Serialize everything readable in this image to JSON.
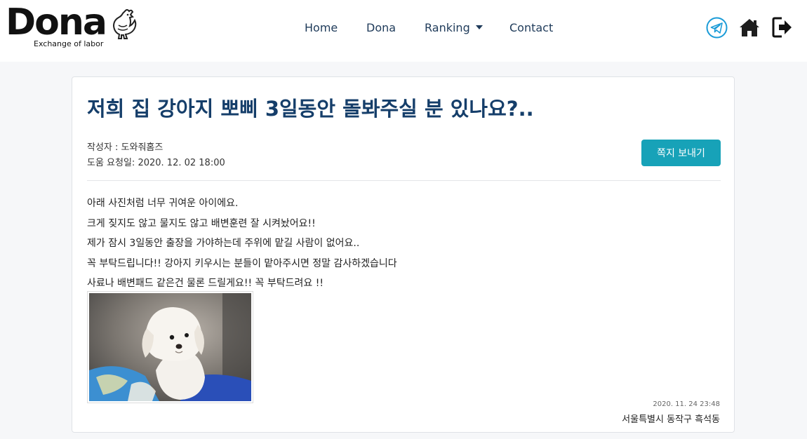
{
  "brand": {
    "name": "Dona",
    "tagline": "Exchange of labor"
  },
  "nav": {
    "home": "Home",
    "dona": "Dona",
    "ranking": "Ranking",
    "contact": "Contact"
  },
  "icons": {
    "telegram": "telegram-icon",
    "home": "home-icon",
    "exit": "sign-out-icon"
  },
  "colors": {
    "title": "#153e6a",
    "button": "#17a2b8",
    "nav": "#1f3b5a"
  },
  "post": {
    "title": "저희 집 강아지 뽀삐 3일동안 돌봐주실 분 있나요?..",
    "author_line": "작성자 : 도와줘홈즈",
    "request_date_line": "도움 요청일: 2020. 12. 02 18:00",
    "message_button": "쪽지 보내기",
    "body": [
      "아래 사진처럼 너무 귀여운 아이에요.",
      "크게 짖지도 않고 물지도 않고 배변훈련 잘 시켜놨어요!!",
      "제가 잠시 3일동안 출장을 가야하는데 주위에 맡길 사람이 없어요..",
      "꼭 부탁드립니다!! 강아지 키우시는 분들이 맡아주시면 정말 감사하겠습니다",
      "사료나 배변패드 같은건 물론 드릴게요!! 꼭 부탁드려요 !!"
    ],
    "posted_at": "2020. 11. 24 23:48",
    "location": "서울특별시 동작구 흑석동"
  }
}
